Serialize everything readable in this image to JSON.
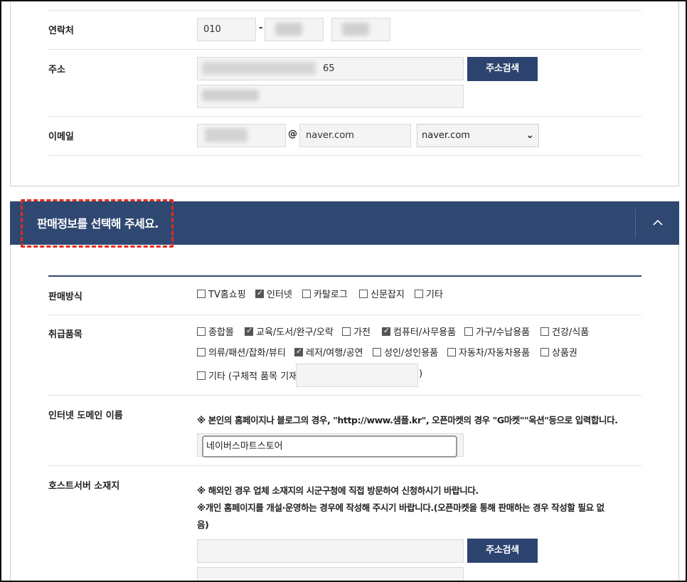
{
  "contact": {
    "label": "연락처",
    "prefix": "010",
    "dash": "-"
  },
  "address": {
    "label": "주소",
    "line1_suffix": "65",
    "search_button": "주소검색"
  },
  "email": {
    "label": "이메일",
    "at": "@",
    "domain_value": "naver.com",
    "select_value": "naver.com"
  },
  "banner": {
    "title": "판매정보를 선택해 주세요.",
    "collapse_icon": "chevron-up-icon"
  },
  "sales_method": {
    "label": "판매방식",
    "options": [
      {
        "label": "TV홈쇼핑",
        "checked": false
      },
      {
        "label": "인터넷",
        "checked": true
      },
      {
        "label": "카탈로그",
        "checked": false
      },
      {
        "label": "신문잡지",
        "checked": false
      },
      {
        "label": "기타",
        "checked": false
      }
    ]
  },
  "products": {
    "label": "취급품목",
    "row1": [
      {
        "label": "종합몰",
        "checked": false
      },
      {
        "label": "교육/도서/완구/오락",
        "checked": true
      },
      {
        "label": "가전",
        "checked": false
      },
      {
        "label": "컴퓨터/사무용품",
        "checked": true
      },
      {
        "label": "가구/수납용품",
        "checked": false
      },
      {
        "label": "건강/식품",
        "checked": false
      }
    ],
    "row2": [
      {
        "label": "의류/패션/잡화/뷰티",
        "checked": false
      },
      {
        "label": "레저/여행/공연",
        "checked": true
      },
      {
        "label": "성인/성인용품",
        "checked": false
      },
      {
        "label": "자동차/자동차용품",
        "checked": false
      },
      {
        "label": "상품권",
        "checked": false
      }
    ],
    "other_label": "기타 (구체적 품목 기재:",
    "other_close": ")",
    "other_checked": false
  },
  "domain": {
    "label": "인터넷 도메인 이름",
    "note": "※ 본인의 홈페이지나 블로그의 경우, \"http://www.샘플.kr\", 오픈마켓의 경우 \"G마켓\"\"옥션\"등으로 입력합니다.",
    "value": "네이버스마트스토어"
  },
  "host": {
    "label": "호스트서버 소재지",
    "note1": "※ 해외인 경우 업체 소재지의 시군구청에 직접 방문하여 신청하시기 바랍니다.",
    "note2a": "※개인 홈페이지를 개설·운영하는 경우에 작성해 주시기 바랍니다.(오픈마켓을 통해 판매하는 경우 작성할 필요 없",
    "note2b": "음)",
    "search_button": "주소검색"
  }
}
